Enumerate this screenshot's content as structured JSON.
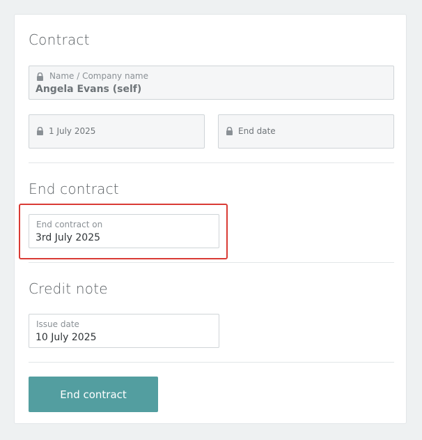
{
  "contract": {
    "title": "Contract",
    "name_field": {
      "label": "Name / Company name",
      "value": "Angela Evans (self)"
    },
    "start_date_field": {
      "value": "1 July 2025"
    },
    "end_date_field": {
      "placeholder": "End date"
    }
  },
  "end_contract": {
    "title": "End contract",
    "end_on_field": {
      "label": "End contract on",
      "value": "3rd July 2025"
    }
  },
  "credit_note": {
    "title": "Credit note",
    "issue_date_field": {
      "label": "Issue date",
      "value": "10 July 2025"
    }
  },
  "actions": {
    "end_contract_label": "End contract"
  },
  "colors": {
    "accent": "#539ea0",
    "highlight": "#d93a34"
  },
  "icons": [
    "lock-icon"
  ]
}
